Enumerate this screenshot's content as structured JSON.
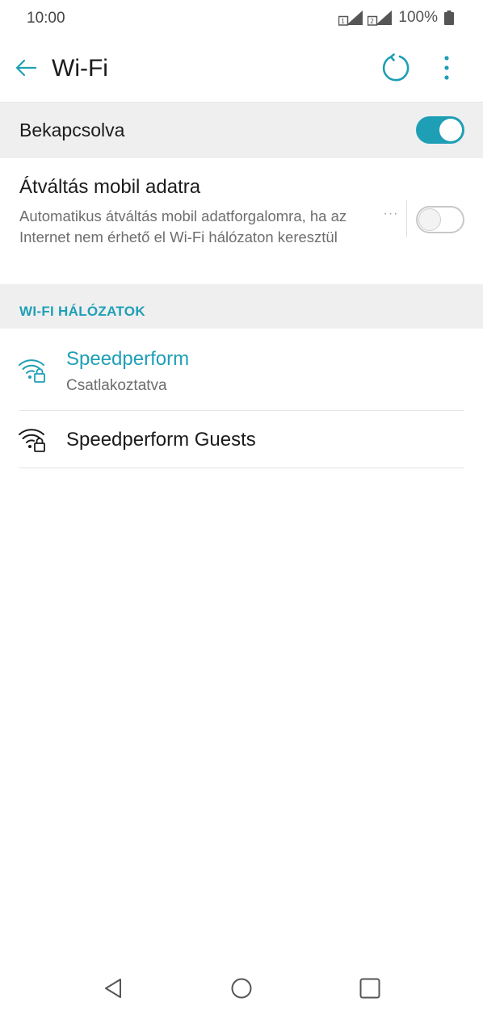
{
  "status_bar": {
    "time": "10:00",
    "battery_text": "100%",
    "icons": [
      "sim1-signal-icon",
      "sim2-signal-icon",
      "battery-icon"
    ]
  },
  "app_bar": {
    "title": "Wi-Fi",
    "icons": [
      "back-arrow-icon",
      "refresh-icon",
      "more-vert-icon"
    ]
  },
  "main_switch": {
    "label": "Bekapcsolva",
    "state": "on"
  },
  "mobile_data_switch": {
    "title": "Átváltás mobil adatra",
    "description": "Automatikus átváltás mobil adatforgalomra, ha az Internet nem érhető el Wi-Fi hálózaton keresztül",
    "more": "···",
    "state": "off"
  },
  "networks_section": {
    "header": "WI-FI HÁLÓZATOK",
    "items": [
      {
        "name": "Speedperform",
        "status": "Csatlakoztatva",
        "connected": true,
        "icon": "wifi-lock-icon"
      },
      {
        "name": "Speedperform Guests",
        "status": "",
        "connected": false,
        "icon": "wifi-lock-icon"
      }
    ]
  },
  "colors": {
    "accent": "#1e9fb5",
    "section_bg": "#efefef",
    "text_primary": "#1b1b1b",
    "text_secondary": "#6e6e6e"
  },
  "nav_bar": {
    "icons": [
      "back-triangle-icon",
      "home-circle-icon",
      "recents-square-icon"
    ]
  }
}
